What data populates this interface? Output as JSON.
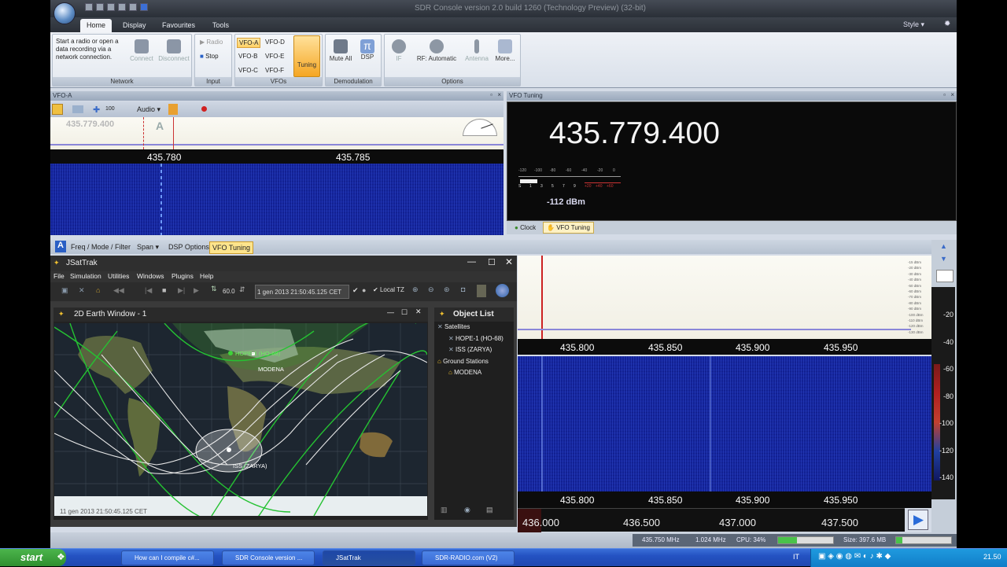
{
  "app": {
    "title": "SDR Console version 2.0 build 1260 (Technology Preview) (32-bit)",
    "style_label": "Style"
  },
  "ribbon": {
    "tabs": [
      "Home",
      "Display",
      "Favourites",
      "Tools"
    ],
    "network": {
      "description": "Start a radio or open a data recording via a network connection.",
      "connect": "Connect",
      "disconnect": "Disconnect",
      "label": "Network"
    },
    "input": {
      "radio": "Radio",
      "stop": "Stop",
      "label": "Input"
    },
    "vfos": {
      "items": [
        "VFO-A",
        "VFO-D",
        "VFO-B",
        "VFO-E",
        "VFO-C",
        "VFO-F"
      ],
      "tuning": "Tuning",
      "label": "VFOs"
    },
    "demod": {
      "mute": "Mute All",
      "dsp": "DSP",
      "label": "Demodulation"
    },
    "options": {
      "if": "IF",
      "rf": "RF: Automatic",
      "antenna": "Antenna",
      "more": "More...",
      "label": "Options"
    }
  },
  "vfo_a": {
    "title": "VFO-A",
    "zoom": "100",
    "audio": "Audio",
    "frequency": "435.779.400",
    "marker": "A",
    "scale": [
      "435.780",
      "435.785"
    ]
  },
  "vfo_tuning": {
    "title": "VFO Tuning",
    "frequency": "435.779.400",
    "meter_top": [
      "-120",
      "-100",
      "-80",
      "-60",
      "-40",
      "-20",
      "0"
    ],
    "meter_bottom": [
      "S",
      "1",
      "3",
      "5",
      "7",
      "9",
      "+20",
      "+40",
      "+60"
    ],
    "level": "-112 dBm",
    "tabs": [
      "Clock",
      "VFO Tuning"
    ]
  },
  "lower_tabs": {
    "marker": "A",
    "items": [
      "Freq / Mode / Filter",
      "Span",
      "DSP Options",
      "VFO Tuning"
    ]
  },
  "jsattrak": {
    "title": "JSatTrak",
    "menu": [
      "File",
      "Simulation",
      "Utilities",
      "Windows",
      "Plugins",
      "Help"
    ],
    "step": "60.0",
    "datetime": "1 gen 2013 21:50:45.125 CET",
    "local_tz": "Local TZ",
    "earth_title": "2D Earth Window - 1",
    "earth_time": "11 gen 2013 21:50:45.125 CET",
    "labels": {
      "hope": "HOPE-1 (HO-68)",
      "modena": "MODENA",
      "iss": "ISS (ZARYA)"
    },
    "object_list": {
      "title": "Object List",
      "satellites": "Satellites",
      "sat_items": [
        "HOPE-1 (HO-68)",
        "ISS (ZARYA)"
      ],
      "ground": "Ground Stations",
      "ground_items": [
        "MODENA"
      ]
    }
  },
  "spectrum": {
    "db_small": [
      "-15 dBm",
      "-20 dBm",
      "-30 dBm",
      "-40 dBm",
      "-50 dBm",
      "-60 dBm",
      "-70 dBm",
      "-80 dBm",
      "-90 dBm",
      "-100 dBm",
      "-110 dBm",
      "-120 dBm",
      "-130 dBm"
    ],
    "scale": [
      "435.800",
      "435.850",
      "435.900",
      "435.950"
    ],
    "db_right": [
      "-20",
      "-40",
      "-60",
      "-80",
      "-100",
      "-120",
      "-140"
    ],
    "wide_scale": [
      "436.000",
      "436.500",
      "437.000",
      "437.500"
    ]
  },
  "status": {
    "freq": "435.750 MHz",
    "span": "1.024 MHz",
    "cpu": "CPU: 34%",
    "size": "Size: 397.6 MB"
  },
  "taskbar": {
    "start": "start",
    "tasks": [
      "How can I compile c#...",
      "SDR Console version ...",
      "JSatTrak",
      "SDR-RADIO.com (V2)"
    ],
    "lang": "IT",
    "clock": "21.50"
  }
}
